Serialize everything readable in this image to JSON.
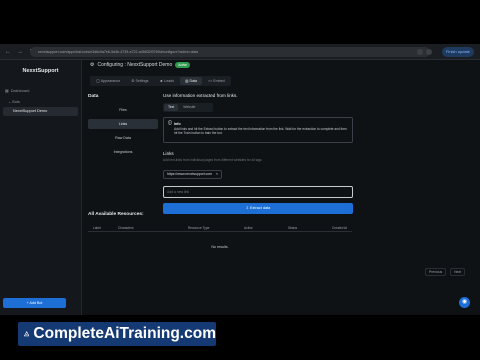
{
  "browser": {
    "url": "nexxtsupport.com/app/chat-bots/e3d6c9a7e6-5d4b-4739-a722-a45832f3769d/configure?active=data",
    "finish_label": "Finish update",
    "colors": {
      "chrome_bg": "#1a1d21",
      "accent": "#1d6fd6"
    }
  },
  "sidebar": {
    "brand": "NexxtSupport",
    "dashboard_label": "Dashboard",
    "bots_label": "Bots",
    "active_bot": "NexxtSupport Demo",
    "add_button": "+ Add Bot"
  },
  "header": {
    "title": "Configuring : NexxtSupport Demo",
    "status_badge": "Active",
    "tabs": [
      {
        "label": "Appearance",
        "icon": "palette-icon"
      },
      {
        "label": "Settings",
        "icon": "gear-icon"
      },
      {
        "label": "Leads",
        "icon": "user-icon"
      },
      {
        "label": "Data",
        "icon": "database-icon",
        "active": true
      },
      {
        "label": "Embed",
        "icon": "code-icon"
      }
    ]
  },
  "data_section": {
    "heading": "Data",
    "sub_nav": [
      "Files",
      "Links",
      "Raw Data",
      "Integrations"
    ],
    "active_sub": "Links"
  },
  "panel": {
    "title": "Use information extracted from links.",
    "mode_tabs": [
      "Text",
      "Website"
    ],
    "info_title": "Info",
    "info_text": "Add links and hit the Extract button to extract the text information from the link. Wait for the extraction to complete and then hit the Train button to train the bot.",
    "links_heading": "Links",
    "links_help": "Add text-links from individual pages from different websites for all tags",
    "existing_link": "https://www.nexxtsupport.com",
    "input_placeholder": "Add a new link",
    "extract_button": "Extract data"
  },
  "resources": {
    "heading": "All Available Resources:",
    "columns": [
      "Label",
      "Characters",
      "Resource Type",
      "Active",
      "Status",
      "Created At"
    ],
    "empty_text": "No results.",
    "previous": "Previous",
    "next": "Next"
  },
  "banner": {
    "text": "CompleteAiTraining.com",
    "bg": "#153a73"
  }
}
